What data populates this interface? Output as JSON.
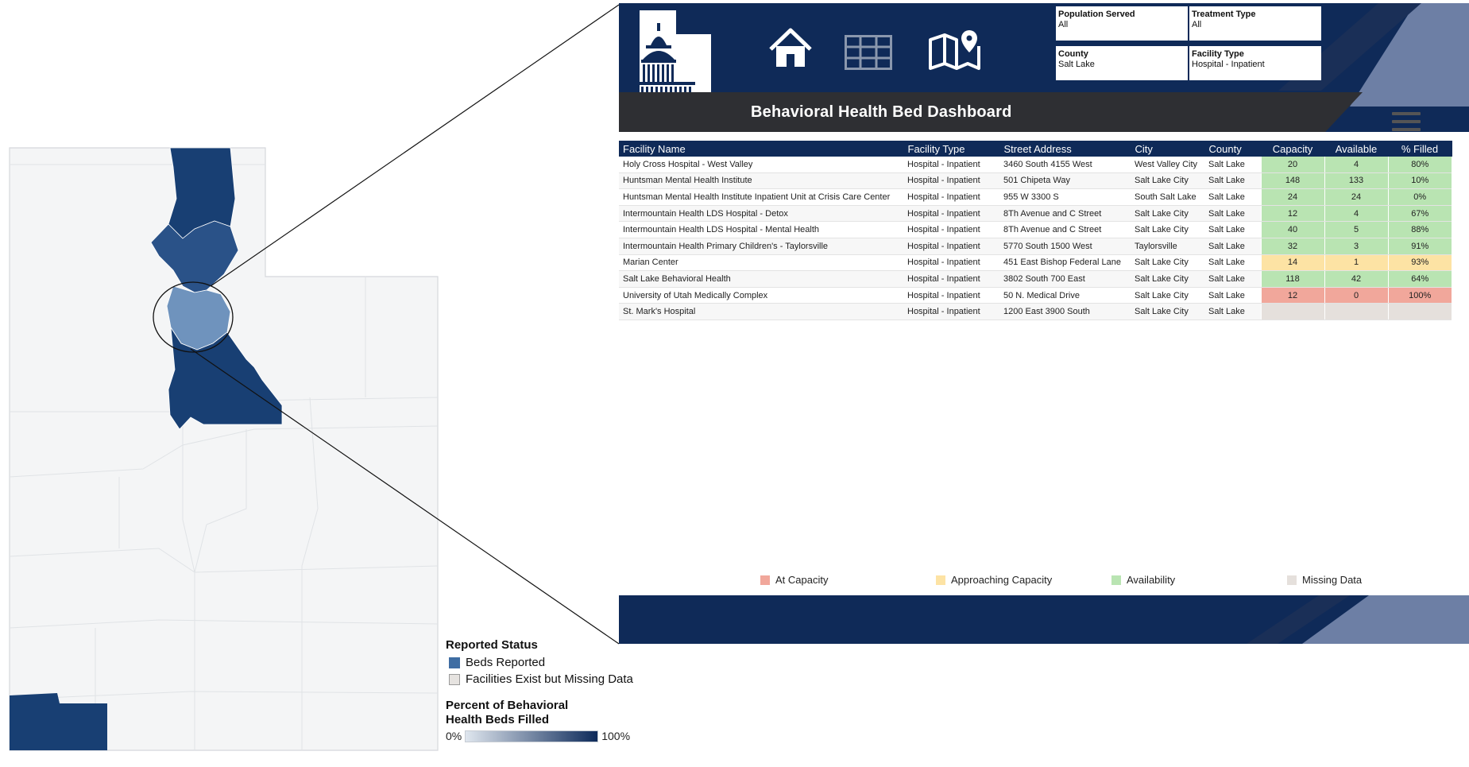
{
  "dashboard": {
    "title": "Behavioral Health Bed Dashboard",
    "nav": [
      "home-icon",
      "table-grid-icon",
      "map-pin-icon"
    ],
    "filters": [
      {
        "label": "Population Served",
        "value": "All"
      },
      {
        "label": "Treatment Type",
        "value": "All"
      },
      {
        "label": "County",
        "value": "Salt Lake"
      },
      {
        "label": "Facility Type",
        "value": "Hospital - Inpatient"
      }
    ],
    "columns": [
      "Facility Name",
      "Facility Type",
      "Street Address",
      "City",
      "County",
      "Capacity",
      "Available",
      "% Filled"
    ],
    "rows": [
      {
        "name": "Holy Cross Hospital - West Valley",
        "type": "Hospital - Inpatient",
        "address": "3460 South 4155 West",
        "city": "West Valley City",
        "county": "Salt Lake",
        "capacity": "20",
        "available": "4",
        "filled": "80%",
        "status": "avail"
      },
      {
        "name": "Huntsman Mental Health Institute",
        "type": "Hospital - Inpatient",
        "address": "501 Chipeta Way",
        "city": "Salt Lake City",
        "county": "Salt Lake",
        "capacity": "148",
        "available": "133",
        "filled": "10%",
        "status": "avail"
      },
      {
        "name": "Huntsman Mental Health Institute Inpatient Unit at Crisis Care Center",
        "type": "Hospital - Inpatient",
        "address": "955 W 3300 S",
        "city": "South Salt Lake",
        "county": "Salt Lake",
        "capacity": "24",
        "available": "24",
        "filled": "0%",
        "status": "avail"
      },
      {
        "name": "Intermountain Health LDS Hospital - Detox",
        "type": "Hospital - Inpatient",
        "address": "8Th Avenue and C Street",
        "city": "Salt Lake City",
        "county": "Salt Lake",
        "capacity": "12",
        "available": "4",
        "filled": "67%",
        "status": "avail"
      },
      {
        "name": "Intermountain Health LDS Hospital - Mental Health",
        "type": "Hospital - Inpatient",
        "address": "8Th Avenue and C Street",
        "city": "Salt Lake City",
        "county": "Salt Lake",
        "capacity": "40",
        "available": "5",
        "filled": "88%",
        "status": "avail"
      },
      {
        "name": "Intermountain Health Primary Children's - Taylorsville",
        "type": "Hospital - Inpatient",
        "address": "5770 South 1500 West",
        "city": "Taylorsville",
        "county": "Salt Lake",
        "capacity": "32",
        "available": "3",
        "filled": "91%",
        "status": "avail"
      },
      {
        "name": "Marian Center",
        "type": "Hospital - Inpatient",
        "address": "451 East Bishop Federal Lane",
        "city": "Salt Lake City",
        "county": "Salt Lake",
        "capacity": "14",
        "available": "1",
        "filled": "93%",
        "status": "approach"
      },
      {
        "name": "Salt Lake Behavioral Health",
        "type": "Hospital - Inpatient",
        "address": "3802 South 700 East",
        "city": "Salt Lake City",
        "county": "Salt Lake",
        "capacity": "118",
        "available": "42",
        "filled": "64%",
        "status": "avail"
      },
      {
        "name": "University of Utah Medically Complex",
        "type": "Hospital - Inpatient",
        "address": "50 N. Medical Drive",
        "city": "Salt Lake City",
        "county": "Salt Lake",
        "capacity": "12",
        "available": "0",
        "filled": "100%",
        "status": "atcap"
      },
      {
        "name": "St. Mark's Hospital",
        "type": "Hospital - Inpatient",
        "address": "1200 East 3900 South",
        "city": "Salt Lake City",
        "county": "Salt Lake",
        "capacity": "",
        "available": "",
        "filled": "",
        "status": "missing"
      }
    ],
    "status_legend": [
      {
        "label": "At Capacity",
        "color": "#f1a79b"
      },
      {
        "label": "Approaching Capacity",
        "color": "#fde3a4"
      },
      {
        "label": "Availability",
        "color": "#b9e4b2"
      },
      {
        "label": "Missing Data",
        "color": "#e5e0dc"
      }
    ]
  },
  "map": {
    "legend": {
      "reported_title": "Reported Status",
      "beds_reported": "Beds Reported",
      "missing": "Facilities Exist but Missing Data",
      "percent_title": "Percent of Behavioral Health Beds Filled",
      "min": "0%",
      "max": "100%"
    },
    "colors": {
      "dark": "#183f73",
      "mid": "#3f6da3",
      "light": "#6f93bd",
      "base": "#f3f4f5"
    }
  }
}
